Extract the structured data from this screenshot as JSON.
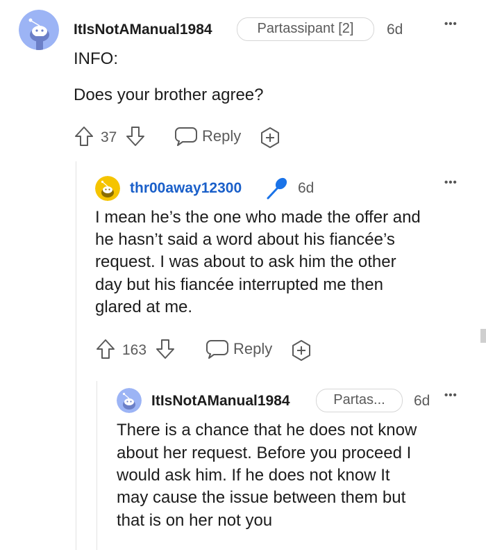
{
  "comments": [
    {
      "username": "ItIsNotAManual1984",
      "flair": "Partassipant [2]",
      "time": "6d",
      "more": "•••",
      "body_lines": [
        "INFO:",
        "Does your brother agree?"
      ],
      "votes": "37",
      "reply_label": "Reply",
      "avatar_color": "#9cb4f5"
    },
    {
      "username": "thr00away12300",
      "time": "6d",
      "more": "•••",
      "body_lines": [
        "I mean he’s the one who made the offer and",
        "he hasn’t said a word about his fiancée’s",
        "request. I was about to ask him the other",
        "day but his fiancée interrupted me then",
        "glared at me."
      ],
      "votes": "163",
      "reply_label": "Reply",
      "avatar_color": "#f5c400",
      "username_color": "#1a5fc9",
      "mic_color": "#1a73e8"
    },
    {
      "username": "ItIsNotAManual1984",
      "flair": "Partas...",
      "time": "6d",
      "more": "•••",
      "body_lines": [
        "There is a chance that he does not know",
        "about her request. Before you proceed I",
        "would ask him. If he does not know It",
        "may cause the issue between them but",
        "that is on her not you"
      ],
      "avatar_color": "#9cb4f5"
    }
  ]
}
